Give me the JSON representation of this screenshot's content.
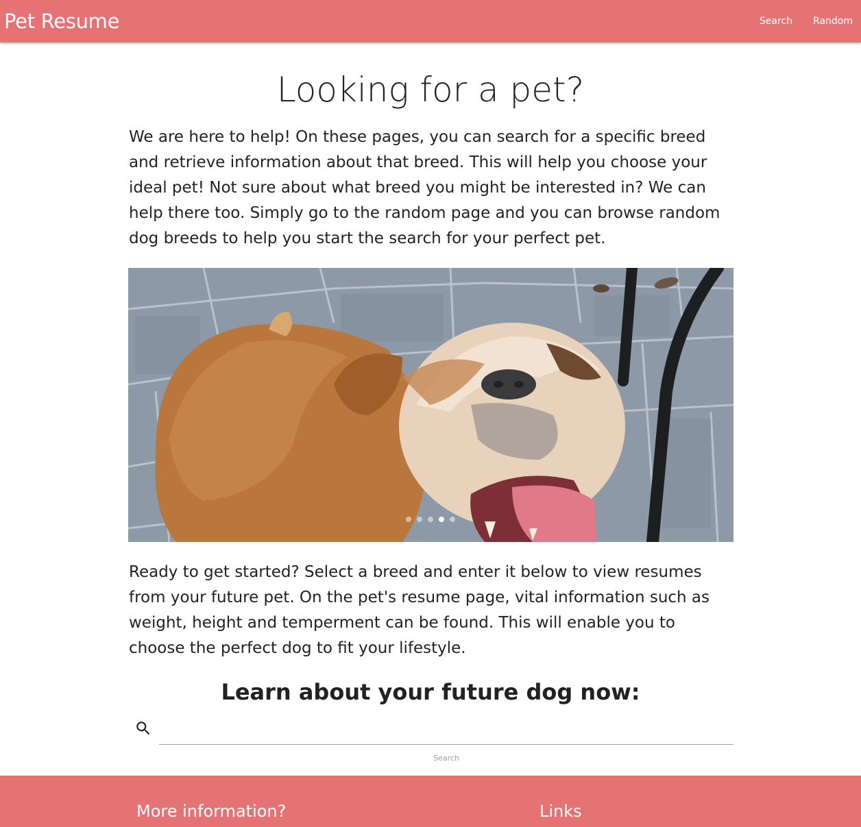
{
  "navbar": {
    "brand": "Pet Resume",
    "links": [
      {
        "label": "Search"
      },
      {
        "label": "Random"
      }
    ]
  },
  "hero": {
    "title": "Looking for a pet?",
    "intro": "We are here to help! On these pages, you can search for a specific breed and retrieve information about that breed. This will help you choose your ideal pet! Not sure about what breed you might be interested in? We can help there too. Simply go to the random page and you can browse random dog breeds to help you start the search for your perfect pet."
  },
  "carousel": {
    "slide_count": 5,
    "active_index": 3
  },
  "ready": {
    "text": "Ready to get started? Select a breed and enter it below to view resumes from your future pet. On the pet's resume page, vital information such as weight, height and temperment can be found. This will enable you to choose the perfect dog to fit your lifestyle."
  },
  "search": {
    "heading": "Learn about your future dog now:",
    "value": "",
    "label": "Search",
    "icon": "search-icon"
  },
  "footer": {
    "more_info_heading": "More information?",
    "links_heading": "Links"
  },
  "colors": {
    "brand": "#e57373"
  }
}
